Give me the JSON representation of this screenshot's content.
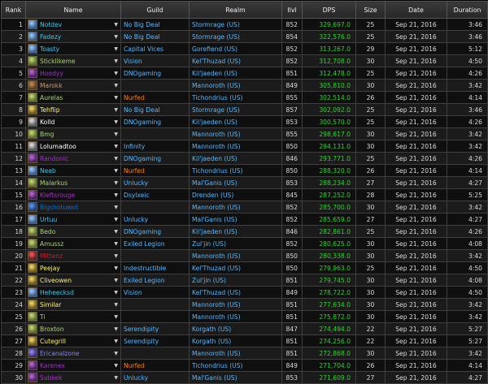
{
  "columns": [
    "Rank",
    "Name",
    "Guild",
    "Realm",
    "Ilvl",
    "DPS",
    "Size",
    "Date",
    "Duration"
  ],
  "class_colors": {
    "mage": "#3fc7eb",
    "hunter": "#aad372",
    "warlock": "#8788ee",
    "paladin": "#f48cba",
    "rogue": "#fff468",
    "druid": "#ff7c0a",
    "priest": "#ffffff",
    "dk": "#c41e3a",
    "monk": "#00ff98",
    "dh": "#a330c9"
  },
  "rows": [
    {
      "rank": "1",
      "name": "Notdev",
      "class": "mage",
      "guild": "No Big Deal",
      "realm": "Stormrage (US)",
      "ilvl": "852",
      "dps": "329,697.0",
      "size": "25",
      "date": "Sep 21, 2016",
      "duration": "3:46"
    },
    {
      "rank": "2",
      "name": "Fadezy",
      "class": "mage",
      "guild": "No Big Deal",
      "realm": "Stormrage (US)",
      "ilvl": "854",
      "dps": "322,576.0",
      "size": "25",
      "date": "Sep 21, 2016",
      "duration": "3:46"
    },
    {
      "rank": "3",
      "name": "Toasty",
      "class": "mage",
      "guild": "Capital Vices",
      "realm": "Gorefiend (US)",
      "ilvl": "852",
      "dps": "313,267.0",
      "size": "29",
      "date": "Sep 21, 2016",
      "duration": "5:12"
    },
    {
      "rank": "4",
      "name": "Sticklikeme",
      "class": "hunter",
      "guild": "Vision",
      "realm": "Kel'Thuzad (US)",
      "ilvl": "852",
      "dps": "312,708.0",
      "size": "30",
      "date": "Sep 21, 2016",
      "duration": "4:50"
    },
    {
      "rank": "5",
      "name": "Hoodyy",
      "class": "dh",
      "guild": "DNOgaming",
      "realm": "Kil'jaeden (US)",
      "ilvl": "851",
      "dps": "312,478.0",
      "size": "25",
      "date": "Sep 21, 2016",
      "duration": "4:26"
    },
    {
      "rank": "6",
      "name": "Marokk",
      "class": "warrior",
      "guild": "",
      "realm": "Mannoroth (US)",
      "ilvl": "849",
      "dps": "305,810.0",
      "size": "30",
      "date": "Sep 21, 2016",
      "duration": "3:42"
    },
    {
      "rank": "7",
      "name": "Aurelas",
      "class": "hunter",
      "guild": "Nurfed",
      "guild_legendary": true,
      "realm": "Tichondrius (US)",
      "ilvl": "855",
      "dps": "302,514.0",
      "size": "26",
      "date": "Sep 21, 2016",
      "duration": "4:14"
    },
    {
      "rank": "8",
      "name": "Tehflip",
      "class": "rogue",
      "guild": "No Big Deal",
      "realm": "Stormrage (US)",
      "ilvl": "857",
      "dps": "302,092.0",
      "size": "25",
      "date": "Sep 21, 2016",
      "duration": "3:46"
    },
    {
      "rank": "9",
      "name": "Kolld",
      "class": "priest",
      "guild": "DNOgaming",
      "realm": "Kil'jaeden (US)",
      "ilvl": "853",
      "dps": "300,570.0",
      "size": "25",
      "date": "Sep 21, 2016",
      "duration": "4:26"
    },
    {
      "rank": "10",
      "name": "Bmg",
      "class": "hunter",
      "guild": "",
      "realm": "Mannoroth (US)",
      "ilvl": "855",
      "dps": "298,617.0",
      "size": "30",
      "date": "Sep 21, 2016",
      "duration": "3:42"
    },
    {
      "rank": "11",
      "name": "Lolumadtoo",
      "class": "priest",
      "guild": "Infinity",
      "realm": "Mannoroth (US)",
      "ilvl": "850",
      "dps": "294,131.0",
      "size": "30",
      "date": "Sep 21, 2016",
      "duration": "3:42"
    },
    {
      "rank": "12",
      "name": "Randonic",
      "class": "dh",
      "guild": "DNOgaming",
      "realm": "Kil'jaeden (US)",
      "ilvl": "846",
      "dps": "293,771.0",
      "size": "25",
      "date": "Sep 21, 2016",
      "duration": "4:26"
    },
    {
      "rank": "13",
      "name": "Neeb",
      "class": "mage",
      "guild": "Nurfed",
      "guild_legendary": true,
      "realm": "Tichondrius (US)",
      "ilvl": "850",
      "dps": "288,320.0",
      "size": "26",
      "date": "Sep 21, 2016",
      "duration": "4:14"
    },
    {
      "rank": "14",
      "name": "Malarkus",
      "class": "hunter",
      "guild": "Unlucky",
      "realm": "Mal'Ganis (US)",
      "ilvl": "853",
      "dps": "288,234.0",
      "size": "27",
      "date": "Sep 21, 2016",
      "duration": "4:27"
    },
    {
      "rank": "15",
      "name": "Kleftsrouge",
      "class": "dh",
      "guild": "Dsylxeic",
      "realm": "Drenden (US)",
      "ilvl": "845",
      "dps": "287,252.0",
      "size": "28",
      "date": "Sep 21, 2016",
      "duration": "5:25"
    },
    {
      "rank": "16",
      "name": "Bigshotuwot",
      "class": "shaman",
      "guild": "",
      "realm": "Mannoroth (US)",
      "ilvl": "852",
      "dps": "285,700.0",
      "size": "30",
      "date": "Sep 21, 2016",
      "duration": "3:42"
    },
    {
      "rank": "17",
      "name": "Urtuu",
      "class": "mage",
      "guild": "Unlucky",
      "realm": "Mal'Ganis (US)",
      "ilvl": "852",
      "dps": "285,659.0",
      "size": "27",
      "date": "Sep 21, 2016",
      "duration": "4:27"
    },
    {
      "rank": "18",
      "name": "Bedo",
      "class": "hunter",
      "guild": "DNOgaming",
      "realm": "Kil'jaeden (US)",
      "ilvl": "846",
      "dps": "282,861.0",
      "size": "25",
      "date": "Sep 21, 2016",
      "duration": "4:26"
    },
    {
      "rank": "19",
      "name": "Amussz",
      "class": "hunter",
      "guild": "Exiled Legion",
      "realm": "Zul'jin (US)",
      "ilvl": "852",
      "dps": "280,625.0",
      "size": "30",
      "date": "Sep 21, 2016",
      "duration": "4:08"
    },
    {
      "rank": "20",
      "name": "Mittenz",
      "class": "dk",
      "guild": "",
      "realm": "Mannoroth (US)",
      "ilvl": "850",
      "dps": "280,338.0",
      "size": "30",
      "date": "Sep 21, 2016",
      "duration": "3:42"
    },
    {
      "rank": "21",
      "name": "Peejay",
      "class": "rogue",
      "guild": "Indestructible",
      "realm": "Kel'Thuzad (US)",
      "ilvl": "850",
      "dps": "279,963.0",
      "size": "25",
      "date": "Sep 21, 2016",
      "duration": "4:50"
    },
    {
      "rank": "22",
      "name": "Cliveowen",
      "class": "rogue",
      "guild": "Exiled Legion",
      "realm": "Zul'jin (US)",
      "ilvl": "851",
      "dps": "279,745.0",
      "size": "30",
      "date": "Sep 21, 2016",
      "duration": "4:08"
    },
    {
      "rank": "23",
      "name": "Heheecksd",
      "class": "mage",
      "guild": "Vision",
      "realm": "Kel'Thuzad (US)",
      "ilvl": "849",
      "dps": "278,722.0",
      "size": "30",
      "date": "Sep 21, 2016",
      "duration": "4:50"
    },
    {
      "rank": "24",
      "name": "Similar",
      "class": "rogue",
      "guild": "",
      "realm": "Mannoroth (US)",
      "ilvl": "851",
      "dps": "277,634.0",
      "size": "30",
      "date": "Sep 21, 2016",
      "duration": "3:42"
    },
    {
      "rank": "25",
      "name": "Ti",
      "class": "hunter",
      "guild": "",
      "realm": "Mannoroth (US)",
      "ilvl": "851",
      "dps": "275,872.0",
      "size": "30",
      "date": "Sep 21, 2016",
      "duration": "3:42"
    },
    {
      "rank": "26",
      "name": "Broxton",
      "class": "hunter",
      "guild": "Serendipity",
      "realm": "Korgath (US)",
      "ilvl": "847",
      "dps": "274,494.0",
      "size": "22",
      "date": "Sep 21, 2016",
      "duration": "5:27"
    },
    {
      "rank": "27",
      "name": "Cutegrill",
      "class": "rogue",
      "guild": "Serendipity",
      "realm": "Korgath (US)",
      "ilvl": "851",
      "dps": "274,256.0",
      "size": "22",
      "date": "Sep 21, 2016",
      "duration": "5:27"
    },
    {
      "rank": "28",
      "name": "Ericanalzone",
      "class": "warlock",
      "guild": "",
      "realm": "Mannoroth (US)",
      "ilvl": "851",
      "dps": "272,868.0",
      "size": "30",
      "date": "Sep 21, 2016",
      "duration": "3:42"
    },
    {
      "rank": "29",
      "name": "Karenex",
      "class": "dh",
      "guild": "Nurfed",
      "guild_legendary": true,
      "realm": "Tichondrius (US)",
      "ilvl": "849",
      "dps": "271,704.0",
      "size": "26",
      "date": "Sep 21, 2016",
      "duration": "4:14"
    },
    {
      "rank": "30",
      "name": "Subkek",
      "class": "dh",
      "guild": "Unlucky",
      "realm": "Mal'Ganis (US)",
      "ilvl": "853",
      "dps": "271,609.0",
      "size": "27",
      "date": "Sep 21, 2016",
      "duration": "4:27"
    }
  ]
}
